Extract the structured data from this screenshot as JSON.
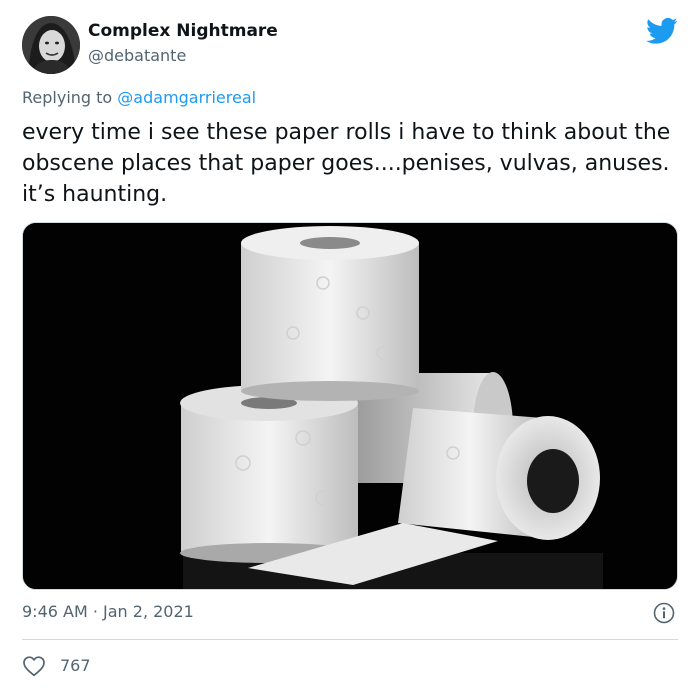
{
  "author": {
    "display_name": "Complex Nightmare",
    "handle": "@debatante"
  },
  "reply": {
    "prefix": "Replying to",
    "mention": "@adamgarriereal"
  },
  "tweet": {
    "text": "every time i see these paper rolls i have to think about the obscene places that paper goes....penises, vulvas, anuses. it’s haunting."
  },
  "meta": {
    "timestamp": "9:46 AM · Jan 2, 2021",
    "likes": "767"
  },
  "colors": {
    "accent": "#1d9bf0",
    "secondary_text": "#536471",
    "divider": "#cfd9de"
  },
  "icons": {
    "brand": "twitter-bird-icon",
    "info": "info-icon",
    "like": "heart-icon"
  }
}
